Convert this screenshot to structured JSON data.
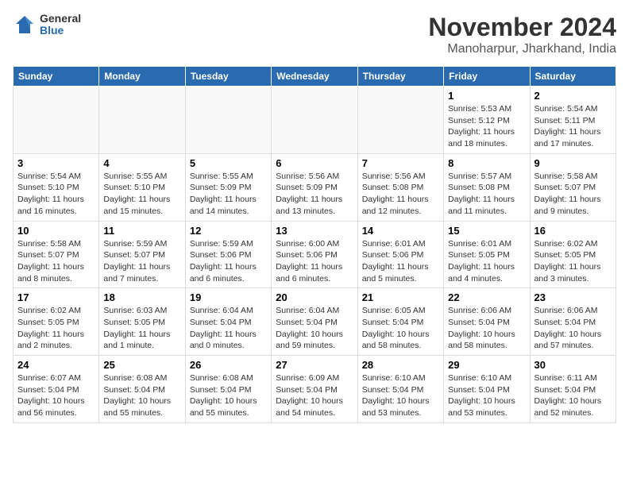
{
  "logo": {
    "general": "General",
    "blue": "Blue"
  },
  "title": "November 2024",
  "location": "Manoharpur, Jharkhand, India",
  "days_of_week": [
    "Sunday",
    "Monday",
    "Tuesday",
    "Wednesday",
    "Thursday",
    "Friday",
    "Saturday"
  ],
  "weeks": [
    [
      {
        "day": "",
        "info": ""
      },
      {
        "day": "",
        "info": ""
      },
      {
        "day": "",
        "info": ""
      },
      {
        "day": "",
        "info": ""
      },
      {
        "day": "",
        "info": ""
      },
      {
        "day": "1",
        "info": "Sunrise: 5:53 AM\nSunset: 5:12 PM\nDaylight: 11 hours and 18 minutes."
      },
      {
        "day": "2",
        "info": "Sunrise: 5:54 AM\nSunset: 5:11 PM\nDaylight: 11 hours and 17 minutes."
      }
    ],
    [
      {
        "day": "3",
        "info": "Sunrise: 5:54 AM\nSunset: 5:10 PM\nDaylight: 11 hours and 16 minutes."
      },
      {
        "day": "4",
        "info": "Sunrise: 5:55 AM\nSunset: 5:10 PM\nDaylight: 11 hours and 15 minutes."
      },
      {
        "day": "5",
        "info": "Sunrise: 5:55 AM\nSunset: 5:09 PM\nDaylight: 11 hours and 14 minutes."
      },
      {
        "day": "6",
        "info": "Sunrise: 5:56 AM\nSunset: 5:09 PM\nDaylight: 11 hours and 13 minutes."
      },
      {
        "day": "7",
        "info": "Sunrise: 5:56 AM\nSunset: 5:08 PM\nDaylight: 11 hours and 12 minutes."
      },
      {
        "day": "8",
        "info": "Sunrise: 5:57 AM\nSunset: 5:08 PM\nDaylight: 11 hours and 11 minutes."
      },
      {
        "day": "9",
        "info": "Sunrise: 5:58 AM\nSunset: 5:07 PM\nDaylight: 11 hours and 9 minutes."
      }
    ],
    [
      {
        "day": "10",
        "info": "Sunrise: 5:58 AM\nSunset: 5:07 PM\nDaylight: 11 hours and 8 minutes."
      },
      {
        "day": "11",
        "info": "Sunrise: 5:59 AM\nSunset: 5:07 PM\nDaylight: 11 hours and 7 minutes."
      },
      {
        "day": "12",
        "info": "Sunrise: 5:59 AM\nSunset: 5:06 PM\nDaylight: 11 hours and 6 minutes."
      },
      {
        "day": "13",
        "info": "Sunrise: 6:00 AM\nSunset: 5:06 PM\nDaylight: 11 hours and 6 minutes."
      },
      {
        "day": "14",
        "info": "Sunrise: 6:01 AM\nSunset: 5:06 PM\nDaylight: 11 hours and 5 minutes."
      },
      {
        "day": "15",
        "info": "Sunrise: 6:01 AM\nSunset: 5:05 PM\nDaylight: 11 hours and 4 minutes."
      },
      {
        "day": "16",
        "info": "Sunrise: 6:02 AM\nSunset: 5:05 PM\nDaylight: 11 hours and 3 minutes."
      }
    ],
    [
      {
        "day": "17",
        "info": "Sunrise: 6:02 AM\nSunset: 5:05 PM\nDaylight: 11 hours and 2 minutes."
      },
      {
        "day": "18",
        "info": "Sunrise: 6:03 AM\nSunset: 5:05 PM\nDaylight: 11 hours and 1 minute."
      },
      {
        "day": "19",
        "info": "Sunrise: 6:04 AM\nSunset: 5:04 PM\nDaylight: 11 hours and 0 minutes."
      },
      {
        "day": "20",
        "info": "Sunrise: 6:04 AM\nSunset: 5:04 PM\nDaylight: 10 hours and 59 minutes."
      },
      {
        "day": "21",
        "info": "Sunrise: 6:05 AM\nSunset: 5:04 PM\nDaylight: 10 hours and 58 minutes."
      },
      {
        "day": "22",
        "info": "Sunrise: 6:06 AM\nSunset: 5:04 PM\nDaylight: 10 hours and 58 minutes."
      },
      {
        "day": "23",
        "info": "Sunrise: 6:06 AM\nSunset: 5:04 PM\nDaylight: 10 hours and 57 minutes."
      }
    ],
    [
      {
        "day": "24",
        "info": "Sunrise: 6:07 AM\nSunset: 5:04 PM\nDaylight: 10 hours and 56 minutes."
      },
      {
        "day": "25",
        "info": "Sunrise: 6:08 AM\nSunset: 5:04 PM\nDaylight: 10 hours and 55 minutes."
      },
      {
        "day": "26",
        "info": "Sunrise: 6:08 AM\nSunset: 5:04 PM\nDaylight: 10 hours and 55 minutes."
      },
      {
        "day": "27",
        "info": "Sunrise: 6:09 AM\nSunset: 5:04 PM\nDaylight: 10 hours and 54 minutes."
      },
      {
        "day": "28",
        "info": "Sunrise: 6:10 AM\nSunset: 5:04 PM\nDaylight: 10 hours and 53 minutes."
      },
      {
        "day": "29",
        "info": "Sunrise: 6:10 AM\nSunset: 5:04 PM\nDaylight: 10 hours and 53 minutes."
      },
      {
        "day": "30",
        "info": "Sunrise: 6:11 AM\nSunset: 5:04 PM\nDaylight: 10 hours and 52 minutes."
      }
    ]
  ]
}
